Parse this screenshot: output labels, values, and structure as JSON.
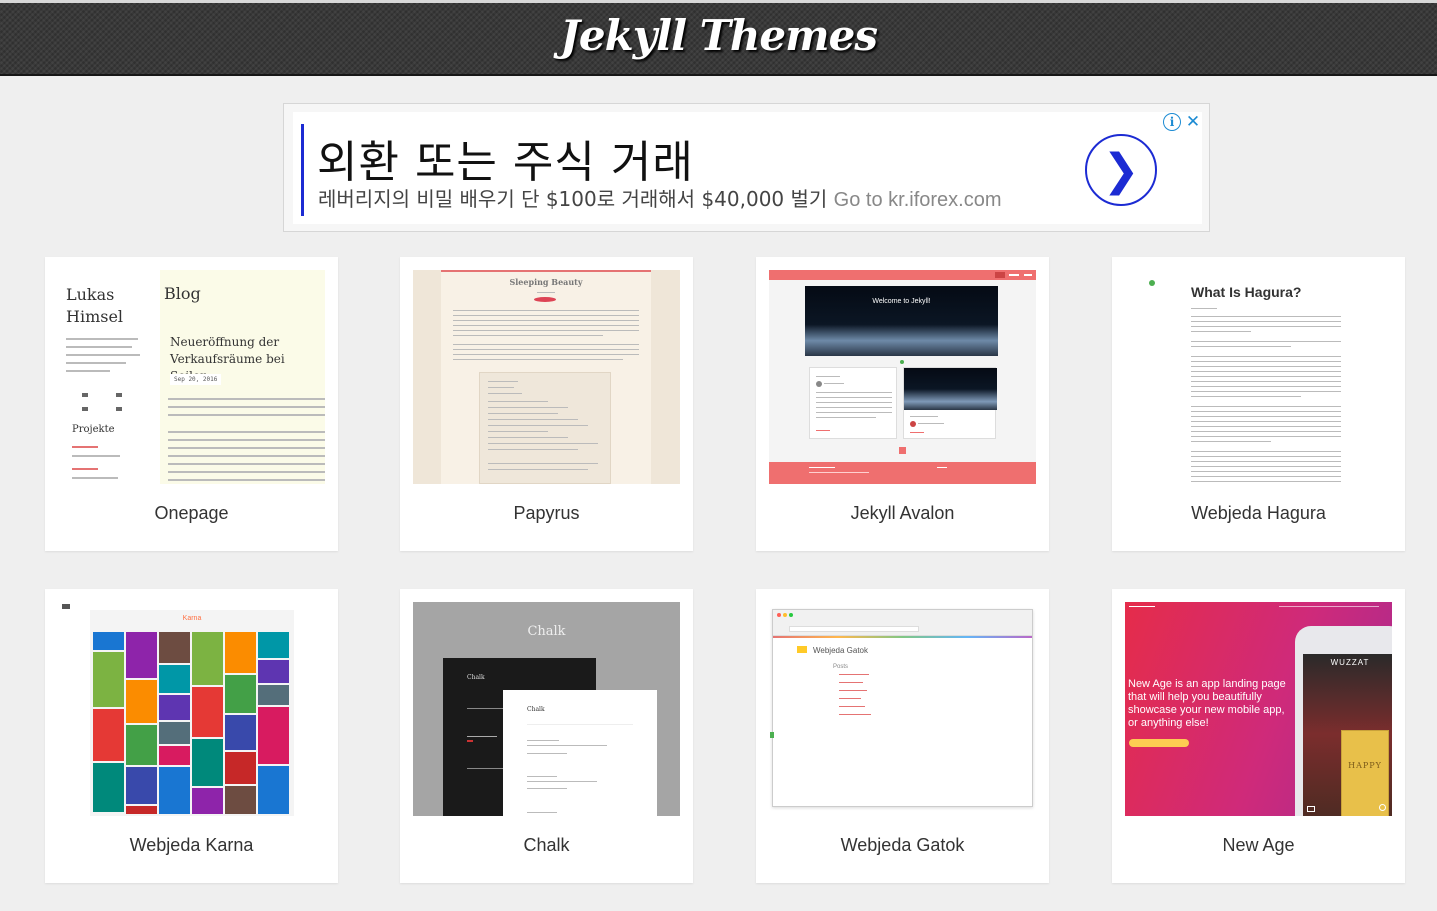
{
  "header": {
    "title": "Jekyll Themes"
  },
  "ad": {
    "headline": "외환 또는 주식 거래",
    "text": "레버리지의 비밀 배우기 단 $100로 거래해서 $40,000 벌기",
    "url_text": "Go to kr.iforex.com",
    "info_icon": "info-icon",
    "close_icon": "close-icon",
    "arrow_icon": "chevron-right-icon",
    "accent_color": "#1c2bd3"
  },
  "themes": [
    {
      "name": "Onepage"
    },
    {
      "name": "Papyrus"
    },
    {
      "name": "Jekyll Avalon"
    },
    {
      "name": "Webjeda Hagura"
    },
    {
      "name": "Webjeda Karna"
    },
    {
      "name": "Chalk"
    },
    {
      "name": "Webjeda Gatok"
    },
    {
      "name": "New Age"
    }
  ],
  "previews": {
    "onepage": {
      "name": "Lukas\nHimsel",
      "blog": "Blog",
      "post_title": "Neueröffnung der Verkaufsräume bei Seiler",
      "date": "Sep 20, 2016",
      "projects": "Projekte"
    },
    "papyrus": {
      "title": "Sleeping Beauty"
    },
    "avalon": {
      "hero": "Welcome to Jekyll!"
    },
    "hagura": {
      "title": "What Is Hagura?"
    },
    "karna": {
      "logo": "Karna"
    },
    "chalk": {
      "title": "Chalk",
      "small_title": "Chalk"
    },
    "gatok": {
      "title": "Webjeda Gatok",
      "posts": "Posts"
    },
    "newage": {
      "tagline": "New Age is an app landing page that will help you beautifully showcase your new mobile app, or anything else!",
      "book": "HAPPY",
      "brand": "WUZZAT"
    }
  }
}
